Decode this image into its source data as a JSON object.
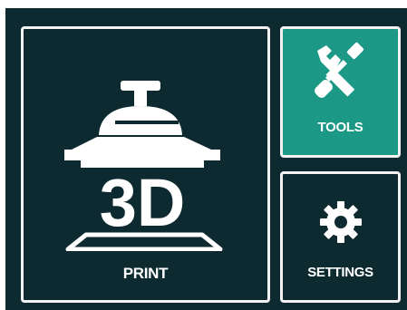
{
  "tiles": {
    "print": {
      "label": "PRINT",
      "icon": "3d-printer-icon",
      "icon_text": "3D"
    },
    "tools": {
      "label": "TOOLS",
      "icon": "tools-icon",
      "state": "selected"
    },
    "settings": {
      "label": "SETTINGS",
      "icon": "gear-icon"
    }
  },
  "colors": {
    "background": "#0d2a30",
    "tile_border": "#f2f2f2",
    "accent": "#1c9886",
    "text": "#ffffff"
  }
}
